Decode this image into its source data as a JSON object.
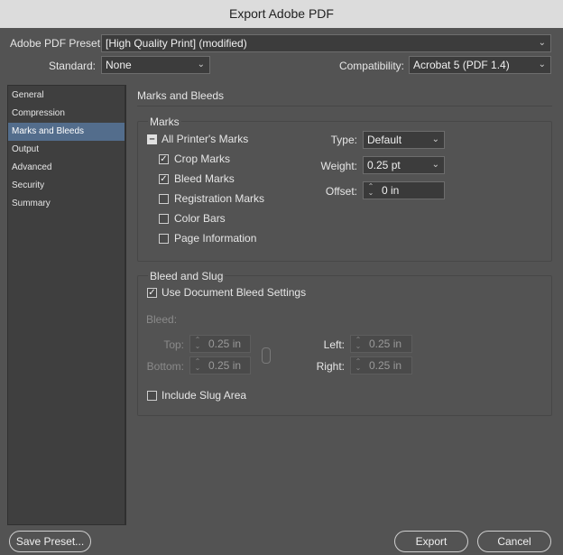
{
  "window": {
    "title": "Export Adobe PDF"
  },
  "preset": {
    "label": "Adobe PDF Preset:",
    "value": "[High Quality Print] (modified)"
  },
  "standard": {
    "label": "Standard:",
    "value": "None"
  },
  "compatibility": {
    "label": "Compatibility:",
    "value": "Acrobat 5 (PDF 1.4)"
  },
  "sidebar": {
    "items": [
      {
        "label": "General"
      },
      {
        "label": "Compression"
      },
      {
        "label": "Marks and Bleeds",
        "active": true
      },
      {
        "label": "Output"
      },
      {
        "label": "Advanced"
      },
      {
        "label": "Security"
      },
      {
        "label": "Summary"
      }
    ]
  },
  "section": {
    "title": "Marks and Bleeds"
  },
  "marks": {
    "group_label": "Marks",
    "all_printers_marks": {
      "label": "All Printer's Marks",
      "state": "mixed"
    },
    "crop_marks": {
      "label": "Crop Marks",
      "checked": true
    },
    "bleed_marks": {
      "label": "Bleed Marks",
      "checked": true
    },
    "registration_marks": {
      "label": "Registration Marks",
      "checked": false
    },
    "color_bars": {
      "label": "Color Bars",
      "checked": false
    },
    "page_information": {
      "label": "Page Information",
      "checked": false
    },
    "type": {
      "label": "Type:",
      "value": "Default"
    },
    "weight": {
      "label": "Weight:",
      "value": "0.25 pt"
    },
    "offset": {
      "label": "Offset:",
      "value": "0 in"
    }
  },
  "bleed_slug": {
    "group_label": "Bleed and Slug",
    "use_document_bleed": {
      "label": "Use Document Bleed Settings",
      "checked": true
    },
    "bleed_label": "Bleed:",
    "top": {
      "label": "Top:",
      "value": "0.25 in"
    },
    "bottom": {
      "label": "Bottom:",
      "value": "0.25 in"
    },
    "left": {
      "label": "Left:",
      "value": "0.25 in"
    },
    "right": {
      "label": "Right:",
      "value": "0.25 in"
    },
    "include_slug": {
      "label": "Include Slug Area",
      "checked": false
    }
  },
  "buttons": {
    "save_preset": "Save Preset...",
    "export": "Export",
    "cancel": "Cancel"
  },
  "icons": {
    "dropdown": "chevron-down-icon",
    "stepper": "stepper-icon",
    "link": "chain-link-icon",
    "checkmark": "checkmark-icon"
  }
}
